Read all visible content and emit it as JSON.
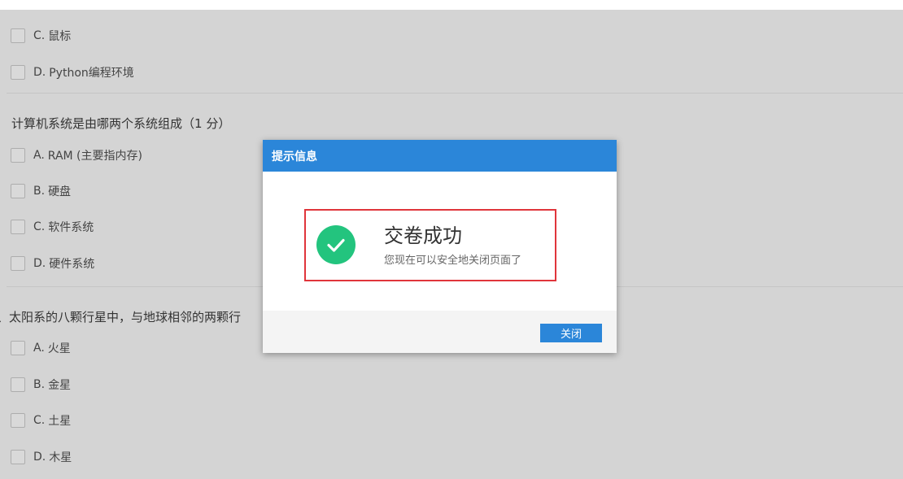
{
  "questions": [
    {
      "title": "",
      "options": [
        {
          "letter": "C.",
          "text": "鼠标"
        },
        {
          "letter": "D.",
          "text": "Python编程环境"
        }
      ]
    },
    {
      "title": "计算机系统是由哪两个系统组成（1 分）",
      "options": [
        {
          "letter": "A.",
          "text": "RAM (主要指内存)"
        },
        {
          "letter": "B.",
          "text": "硬盘"
        },
        {
          "letter": "C.",
          "text": "软件系统"
        },
        {
          "letter": "D.",
          "text": "硬件系统"
        }
      ]
    },
    {
      "title": "、太阳系的八颗行星中，与地球相邻的两颗行",
      "options": [
        {
          "letter": "A.",
          "text": "火星"
        },
        {
          "letter": "B.",
          "text": "金星"
        },
        {
          "letter": "C.",
          "text": "土星"
        },
        {
          "letter": "D.",
          "text": "木星"
        }
      ]
    }
  ],
  "dialog": {
    "title": "提示信息",
    "result_title": "交卷成功",
    "result_message": "您现在可以安全地关闭页面了",
    "close_label": "关闭"
  },
  "colors": {
    "accent": "#2b86d9",
    "success": "#23c47e",
    "highlight_border": "#e0353b",
    "overlay_background": "#d4d4d4"
  }
}
